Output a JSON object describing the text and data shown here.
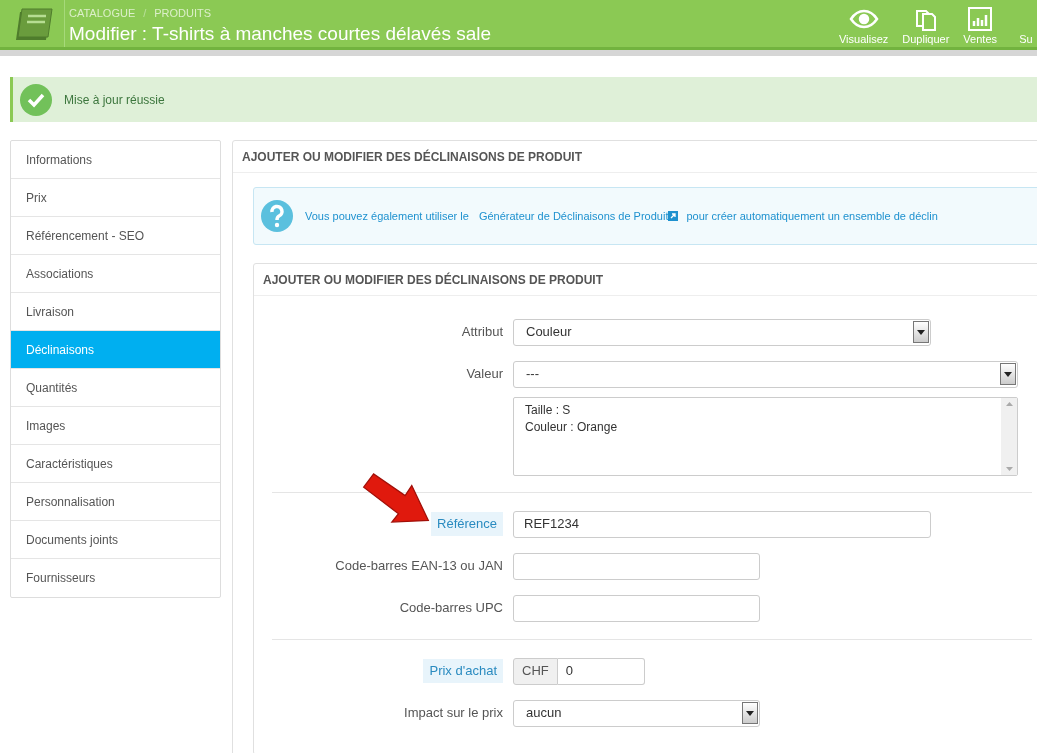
{
  "header": {
    "breadcrumb": [
      "CATALOGUE",
      "PRODUITS"
    ],
    "breadcrumb_separator": "/",
    "title": "Modifier : T-shirts à manches courtes délavés sale",
    "actions": [
      {
        "kind": "eye",
        "label": "Visualisez"
      },
      {
        "kind": "copy",
        "label": "Dupliquer"
      },
      {
        "kind": "chart",
        "label": "Ventes"
      },
      {
        "kind": "none",
        "label": "Su"
      }
    ]
  },
  "alert": {
    "message": "Mise à jour réussie"
  },
  "sidebar": {
    "items": [
      {
        "label": "Informations",
        "selected": false
      },
      {
        "label": "Prix",
        "selected": false
      },
      {
        "label": "Référencement - SEO",
        "selected": false
      },
      {
        "label": "Associations",
        "selected": false
      },
      {
        "label": "Livraison",
        "selected": false
      },
      {
        "label": "Déclinaisons",
        "selected": true
      },
      {
        "label": "Quantités",
        "selected": false
      },
      {
        "label": "Images",
        "selected": false
      },
      {
        "label": "Caractéristiques",
        "selected": false
      },
      {
        "label": "Personnalisation",
        "selected": false
      },
      {
        "label": "Documents joints",
        "selected": false
      },
      {
        "label": "Fournisseurs",
        "selected": false
      }
    ]
  },
  "panel": {
    "title": "AJOUTER OU MODIFIER DES DÉCLINAISONS DE PRODUIT",
    "info": {
      "before": "Vous pouvez également utiliser le",
      "link": "Générateur de Déclinaisons de Produit",
      "after": "pour créer automatiquement un ensemble de déclin"
    },
    "form": {
      "title": "AJOUTER OU MODIFIER DES DÉCLINAISONS DE PRODUIT",
      "groups": [
        [
          {
            "kind": "select",
            "label": "Attribut",
            "value": "Couleur",
            "hint": false
          },
          {
            "kind": "select",
            "label": "Valeur",
            "value": "---",
            "hint": false
          },
          {
            "kind": "list",
            "lines": [
              "Taille : S",
              "Couleur : Orange"
            ]
          }
        ],
        [
          {
            "kind": "text",
            "label": "Référence",
            "value": "REF1234",
            "hint": true
          },
          {
            "kind": "text",
            "label": "Code-barres EAN-13 ou JAN",
            "hint": false
          },
          {
            "kind": "text",
            "label": "Code-barres UPC",
            "hint": false
          }
        ],
        [
          {
            "kind": "money",
            "label": "Prix d'achat",
            "currency": "CHF",
            "value": "0",
            "hint": true
          },
          {
            "kind": "select",
            "label": "Impact sur le prix",
            "value": "aucun",
            "hint": false
          }
        ]
      ]
    }
  }
}
